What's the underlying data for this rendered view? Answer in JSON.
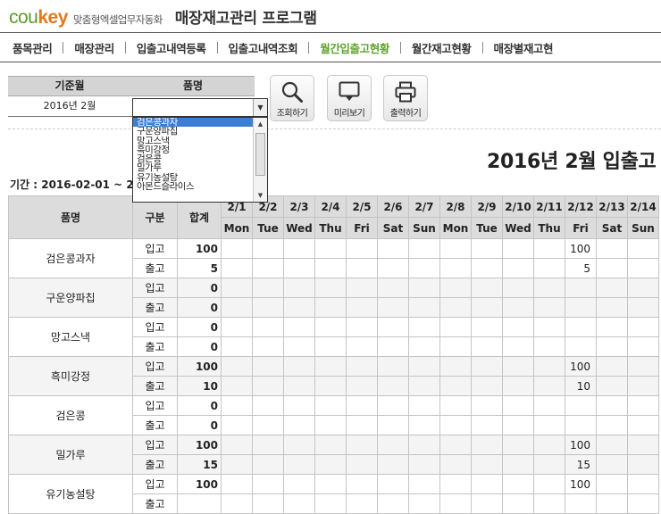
{
  "header": {
    "logo_a": "cou",
    "logo_b": "key",
    "company": "맞춤형엑셀업무자동화",
    "title": "매장재고관리 프로그램"
  },
  "menu": [
    {
      "label": "품목관리",
      "active": false
    },
    {
      "label": "매장관리",
      "active": false
    },
    {
      "label": "입출고내역등록",
      "active": false
    },
    {
      "label": "입출고내역조회",
      "active": false
    },
    {
      "label": "월간입출고현황",
      "active": true
    },
    {
      "label": "월간재고현황",
      "active": false
    },
    {
      "label": "매장별재고현",
      "active": false
    }
  ],
  "filter": {
    "month_label": "기준월",
    "item_label": "품명",
    "month_value": "2016년 2월",
    "item_value": ""
  },
  "dropdown": {
    "items": [
      "검은콩과자",
      "구운양파칩",
      "망고스낵",
      "흑미강정",
      "검은콩",
      "밀가루",
      "유기농설탕",
      "아몬드슬라이스"
    ],
    "selected_index": 0
  },
  "toolbar": {
    "search_label": "조회하기",
    "preview_label": "미리보기",
    "print_label": "출력하기"
  },
  "report": {
    "title": "2016년 2월 입출고",
    "period": "기간 : 2016-02-01 ~ 2"
  },
  "table": {
    "headers": {
      "name": "품명",
      "type": "구분",
      "total": "합계"
    },
    "days": [
      {
        "date": "2/1",
        "dow": "Mon"
      },
      {
        "date": "2/2",
        "dow": "Tue"
      },
      {
        "date": "2/3",
        "dow": "Wed"
      },
      {
        "date": "2/4",
        "dow": "Thu"
      },
      {
        "date": "2/5",
        "dow": "Fri"
      },
      {
        "date": "2/6",
        "dow": "Sat"
      },
      {
        "date": "2/7",
        "dow": "Sun"
      },
      {
        "date": "2/8",
        "dow": "Mon"
      },
      {
        "date": "2/9",
        "dow": "Tue"
      },
      {
        "date": "2/10",
        "dow": "Wed"
      },
      {
        "date": "2/11",
        "dow": "Thu"
      },
      {
        "date": "2/12",
        "dow": "Fri"
      },
      {
        "date": "2/13",
        "dow": "Sat"
      },
      {
        "date": "2/14",
        "dow": "Sun"
      }
    ],
    "in_label": "입고",
    "out_label": "출고",
    "rows": [
      {
        "name": "검은콩과자",
        "in_total": "100",
        "out_total": "5",
        "in_days": [
          "",
          "",
          "",
          "",
          "",
          "",
          "",
          "",
          "",
          "",
          "",
          "100",
          "",
          ""
        ],
        "out_days": [
          "",
          "",
          "",
          "",
          "",
          "",
          "",
          "",
          "",
          "",
          "",
          "5",
          "",
          ""
        ]
      },
      {
        "name": "구운양파칩",
        "in_total": "0",
        "out_total": "0",
        "in_days": [
          "",
          "",
          "",
          "",
          "",
          "",
          "",
          "",
          "",
          "",
          "",
          "",
          "",
          ""
        ],
        "out_days": [
          "",
          "",
          "",
          "",
          "",
          "",
          "",
          "",
          "",
          "",
          "",
          "",
          "",
          ""
        ]
      },
      {
        "name": "망고스낵",
        "in_total": "0",
        "out_total": "0",
        "in_days": [
          "",
          "",
          "",
          "",
          "",
          "",
          "",
          "",
          "",
          "",
          "",
          "",
          "",
          ""
        ],
        "out_days": [
          "",
          "",
          "",
          "",
          "",
          "",
          "",
          "",
          "",
          "",
          "",
          "",
          "",
          ""
        ]
      },
      {
        "name": "흑미강정",
        "in_total": "100",
        "out_total": "10",
        "in_days": [
          "",
          "",
          "",
          "",
          "",
          "",
          "",
          "",
          "",
          "",
          "",
          "100",
          "",
          ""
        ],
        "out_days": [
          "",
          "",
          "",
          "",
          "",
          "",
          "",
          "",
          "",
          "",
          "",
          "10",
          "",
          ""
        ]
      },
      {
        "name": "검은콩",
        "in_total": "0",
        "out_total": "0",
        "in_days": [
          "",
          "",
          "",
          "",
          "",
          "",
          "",
          "",
          "",
          "",
          "",
          "",
          "",
          ""
        ],
        "out_days": [
          "",
          "",
          "",
          "",
          "",
          "",
          "",
          "",
          "",
          "",
          "",
          "",
          "",
          ""
        ]
      },
      {
        "name": "밀가루",
        "in_total": "100",
        "out_total": "15",
        "in_days": [
          "",
          "",
          "",
          "",
          "",
          "",
          "",
          "",
          "",
          "",
          "",
          "100",
          "",
          ""
        ],
        "out_days": [
          "",
          "",
          "",
          "",
          "",
          "",
          "",
          "",
          "",
          "",
          "",
          "15",
          "",
          ""
        ]
      },
      {
        "name": "유기농설탕",
        "in_total": "100",
        "out_total": "",
        "in_days": [
          "",
          "",
          "",
          "",
          "",
          "",
          "",
          "",
          "",
          "",
          "",
          "100",
          "",
          ""
        ],
        "out_days": [
          "",
          "",
          "",
          "",
          "",
          "",
          "",
          "",
          "",
          "",
          "",
          "",
          "",
          ""
        ]
      }
    ]
  }
}
